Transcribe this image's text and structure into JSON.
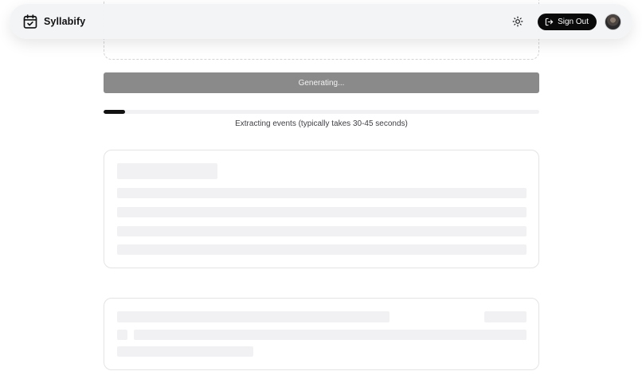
{
  "app": {
    "name": "Syllabify"
  },
  "header": {
    "sign_out_label": "Sign Out",
    "icons": {
      "brand": "calendar-check-icon",
      "theme": "sun-icon",
      "sign_out": "log-out-icon"
    }
  },
  "generate": {
    "button_label": "Generating..."
  },
  "progress": {
    "percent": 5,
    "label": "Extracting events (typically takes 30-45 seconds)"
  },
  "colors": {
    "accent": "#0a0a0a",
    "button_disabled": "#8a8a8a",
    "skeleton": "#f1f1f3",
    "border": "#e4e4e7"
  }
}
